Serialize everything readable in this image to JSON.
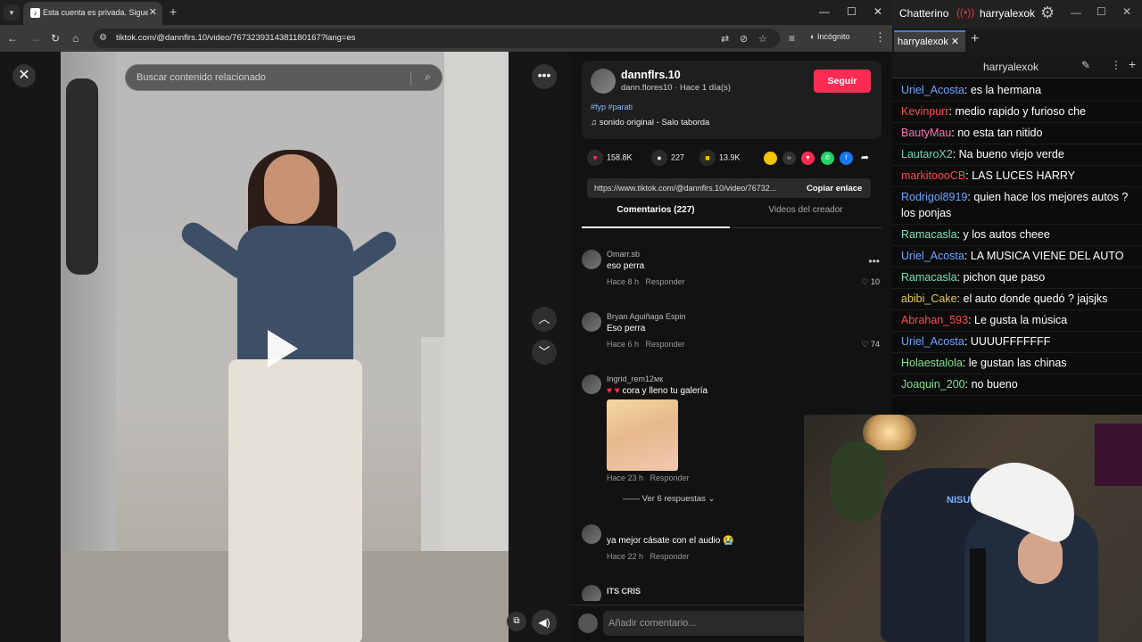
{
  "browser": {
    "tab_title": "Esta cuenta es privada. Sigue e",
    "url": "tiktok.com/@dannflrs.10/video/7673239314381180167?lang=es",
    "incognito_label": "Incógnito"
  },
  "player": {
    "search_placeholder": "Buscar contenido relacionado"
  },
  "post": {
    "username": "dannflrs.10",
    "subline": "dann.flores10 · Hace 1 día(s)",
    "follow_label": "Seguir",
    "hashtags": "#fyp #parati",
    "sound_prefix": "♫",
    "sound": "sonido original - Salo taborda",
    "likes": "158.8K",
    "comments": "227",
    "saves": "13.9K",
    "link": "https://www.tiktok.com/@dannflrs.10/video/76732...",
    "copy_label": "Copiar enlace",
    "tab_comments": "Comentarios (227)",
    "tab_videos": "Videos del creador"
  },
  "comments": [
    {
      "user": "Omarr.sb",
      "text": "eso perra",
      "time": "Hace 8 h",
      "reply": "Responder",
      "likes": "10"
    },
    {
      "user": "Bryan Aguiñaga Espin",
      "text": "Eso perra",
      "time": "Hace 6 h",
      "reply": "Responder",
      "likes": "74"
    },
    {
      "user": "Ingrid_rem12мк",
      "text": "cora y lleno tu galería",
      "time": "Hace 23 h",
      "reply": "Responder",
      "replies": "Ver 6 respuestas"
    },
    {
      "user": "",
      "text": "ya mejor cásate con el audio",
      "time": "Hace 22 h",
      "reply": "Responder"
    },
    {
      "user": "ITS CRIS"
    }
  ],
  "add_comment_placeholder": "Añadir comentario...",
  "chatterino": {
    "app_name": "Chatterino",
    "title_user": "harryalexok",
    "tab": "harryalexok",
    "channel": "harryalexok",
    "messages": [
      {
        "user": "Uriel_Acosta",
        "text": "es la hermana",
        "color": "#6ea6ff"
      },
      {
        "user": "Kevinpurr",
        "text": "medio rapido y furioso che",
        "color": "#ff4a4a"
      },
      {
        "user": "BautyMau",
        "text": "no esta tan nitido",
        "color": "#ff6fb3"
      },
      {
        "user": "LautaroX2",
        "text": "Na bueno viejo verde",
        "color": "#6ed0b0"
      },
      {
        "user": "markitoooCB",
        "text": "LAS LUCES HARRY",
        "color": "#ff4a4a"
      },
      {
        "user": "Rodrigol8919",
        "text": "quien hace los mejores autos ? los ponjas",
        "color": "#6ea6ff"
      },
      {
        "user": "Ramacasla",
        "text": "y los autos cheee",
        "color": "#7de0b0"
      },
      {
        "user": "Uriel_Acosta",
        "text": "LA MUSICA VIENE DEL AUTO",
        "color": "#6ea6ff"
      },
      {
        "user": "Ramacasla",
        "text": "pichon que paso",
        "color": "#7de0b0"
      },
      {
        "user": "abibi_Cake",
        "text": "el auto donde quedó ? jajsjks",
        "color": "#e0c860"
      },
      {
        "user": "Abrahan_593",
        "text": "Le gusta la música",
        "color": "#ff4a4a"
      },
      {
        "user": "Uriel_Acosta",
        "text": "UUUUFFFFFFF",
        "color": "#6ea6ff"
      },
      {
        "user": "Holaestalola",
        "text": "le gustan las chinas",
        "color": "#7de090"
      },
      {
        "user": "Joaquin_200",
        "text": "no bueno",
        "color": "#7de090"
      }
    ]
  },
  "webcam": {
    "chair_label": "NISUTA"
  }
}
